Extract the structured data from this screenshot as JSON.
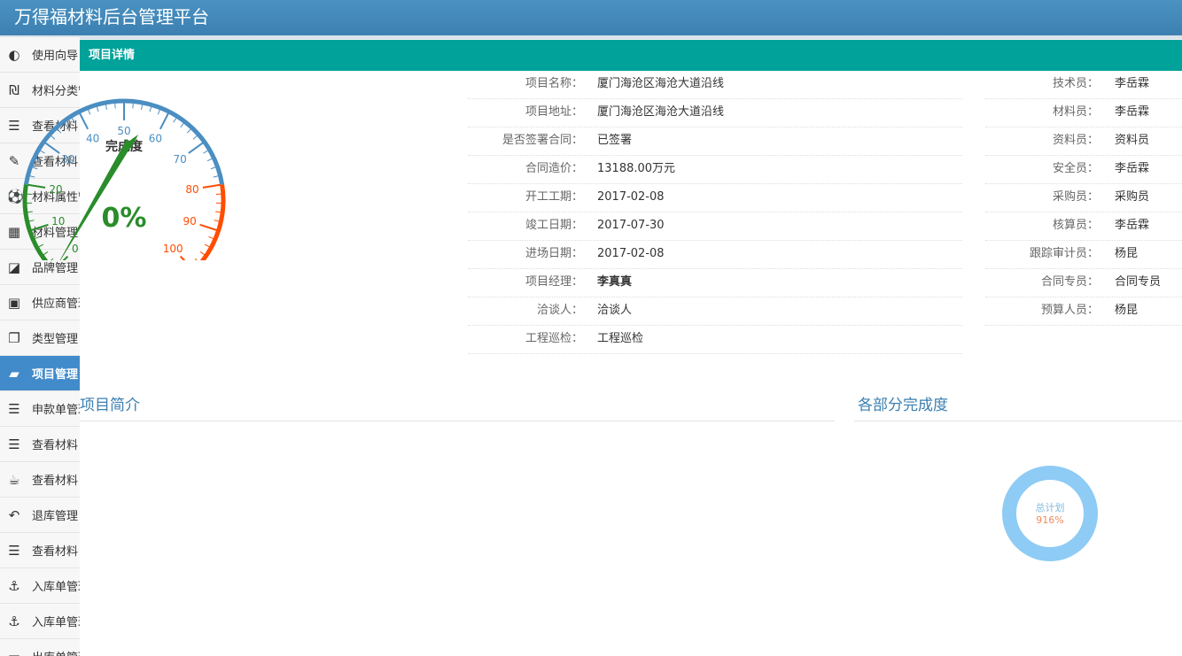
{
  "app": {
    "title": "万得福材料后台管理平台"
  },
  "sidebar": {
    "items": [
      {
        "label": "使用向导",
        "icon": "toggle-icon",
        "glyph": "◐",
        "active": false
      },
      {
        "label": "材料分类管理",
        "icon": "currency-icon",
        "glyph": "₪",
        "active": false
      },
      {
        "label": "查看材料",
        "icon": "list-icon",
        "glyph": "☰",
        "active": false
      },
      {
        "label": "查看材料",
        "icon": "edit-icon",
        "glyph": "✎",
        "active": false
      },
      {
        "label": "材料属性管理",
        "icon": "ball-icon",
        "glyph": "⚽",
        "active": false
      },
      {
        "label": "材料管理",
        "icon": "calculator-icon",
        "glyph": "▦",
        "active": false
      },
      {
        "label": "品牌管理",
        "icon": "tiles-icon",
        "glyph": "◪",
        "active": false
      },
      {
        "label": "供应商管理",
        "icon": "gift-icon",
        "glyph": "▣",
        "active": false
      },
      {
        "label": "类型管理",
        "icon": "copy-icon",
        "glyph": "❐",
        "active": false
      },
      {
        "label": "项目管理",
        "icon": "folder-open-icon",
        "glyph": "▰",
        "active": true
      },
      {
        "label": "申款单管理",
        "icon": "align-justify-icon",
        "glyph": "☰",
        "active": false
      },
      {
        "label": "查看材料",
        "icon": "list-icon",
        "glyph": "☰",
        "active": false
      },
      {
        "label": "查看材料",
        "icon": "coffee-icon",
        "glyph": "☕",
        "active": false
      },
      {
        "label": "退库管理",
        "icon": "reply-all-icon",
        "glyph": "↶",
        "active": false
      },
      {
        "label": "查看材料",
        "icon": "list-icon",
        "glyph": "☰",
        "active": false
      },
      {
        "label": "入库单管理",
        "icon": "anchor-icon",
        "glyph": "⚓",
        "active": false
      },
      {
        "label": "入库单管理",
        "icon": "anchor-icon",
        "glyph": "⚓",
        "active": false
      },
      {
        "label": "出库单管理",
        "icon": "truck-icon",
        "glyph": "▬",
        "active": false
      }
    ]
  },
  "panel": {
    "title": "项目详情"
  },
  "gauge": {
    "label": "完成度",
    "value_text": "0%",
    "value": 0,
    "min": 0,
    "max": 100,
    "ticks": [
      "0",
      "10",
      "20",
      "30",
      "40",
      "50",
      "60",
      "70",
      "80",
      "90",
      "100"
    ],
    "colors": {
      "low": "#2a8c2a",
      "mid": "#4a8ec2",
      "high": "#ff4d00"
    }
  },
  "details_left": [
    {
      "label": "项目名称：",
      "value": "厦门海沧区海沧大道沿线",
      "bold": false
    },
    {
      "label": "项目地址：",
      "value": "厦门海沧区海沧大道沿线",
      "bold": false
    },
    {
      "label": "是否签署合同：",
      "value": "已签署",
      "bold": false
    },
    {
      "label": "合同造价：",
      "value": "13188.00万元",
      "bold": false
    },
    {
      "label": "开工工期：",
      "value": "2017-02-08",
      "bold": false
    },
    {
      "label": "竣工日期：",
      "value": "2017-07-30",
      "bold": false
    },
    {
      "label": "进场日期：",
      "value": "2017-02-08",
      "bold": false
    },
    {
      "label": "项目经理：",
      "value": "李真真",
      "bold": true
    },
    {
      "label": "洽谈人：",
      "value": "洽谈人",
      "bold": false
    },
    {
      "label": "工程巡检：",
      "value": "工程巡检",
      "bold": false
    }
  ],
  "details_right": [
    {
      "label": "技术员：",
      "value": "李岳霖"
    },
    {
      "label": "材料员：",
      "value": "李岳霖"
    },
    {
      "label": "资料员：",
      "value": "资料员"
    },
    {
      "label": "安全员：",
      "value": "李岳霖"
    },
    {
      "label": "采购员：",
      "value": "采购员"
    },
    {
      "label": "核算员：",
      "value": "李岳霖"
    },
    {
      "label": "跟踪审计员：",
      "value": "杨昆"
    },
    {
      "label": "合同专员：",
      "value": "合同专员"
    },
    {
      "label": "预算人员：",
      "value": "杨昆"
    }
  ],
  "sections": {
    "intro_title": "项目简介",
    "progress_title": "各部分完成度"
  },
  "donut": {
    "label": "总计划",
    "value_text": "916%",
    "color": "#8ecbf5",
    "label_color": "#7fb9de",
    "value_color": "#f08a5a"
  }
}
